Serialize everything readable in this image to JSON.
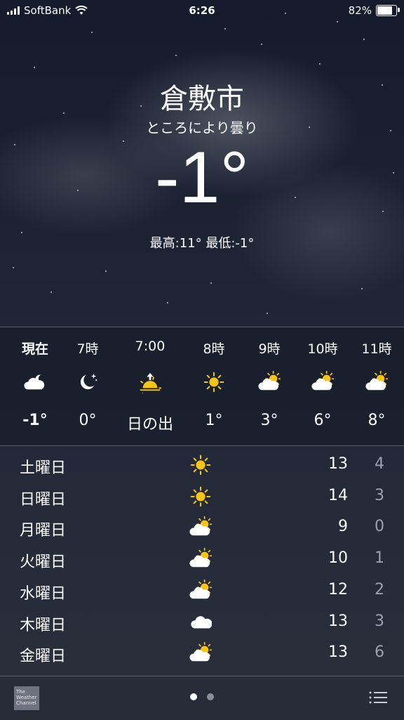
{
  "status_bar": {
    "carrier": "SoftBank",
    "time": "6:26",
    "battery": "82%"
  },
  "location": {
    "city": "倉敷市",
    "condition": "ところにより曇り",
    "temperature": "-1°",
    "hi_lo": "最高:11° 最低:-1°"
  },
  "hourly": [
    {
      "time": "現在",
      "icon": "partly-cloudy-night-icon",
      "value": "-1°",
      "bold": true
    },
    {
      "time": "7時",
      "icon": "moon-stars-icon",
      "value": "0°"
    },
    {
      "time": "7:00",
      "icon": "sunrise-icon",
      "value": "日の出"
    },
    {
      "time": "8時",
      "icon": "sun-icon",
      "value": "1°"
    },
    {
      "time": "9時",
      "icon": "partly-cloudy-day-icon",
      "value": "3°"
    },
    {
      "time": "10時",
      "icon": "partly-cloudy-day-icon",
      "value": "6°"
    },
    {
      "time": "11時",
      "icon": "partly-cloudy-day-icon",
      "value": "8°"
    }
  ],
  "daily": [
    {
      "day": "土曜日",
      "icon": "sun-icon",
      "high": "13",
      "low": "4"
    },
    {
      "day": "日曜日",
      "icon": "sun-icon",
      "high": "14",
      "low": "3"
    },
    {
      "day": "月曜日",
      "icon": "partly-cloudy-day-icon",
      "high": "9",
      "low": "0"
    },
    {
      "day": "火曜日",
      "icon": "partly-cloudy-day-icon",
      "high": "10",
      "low": "1"
    },
    {
      "day": "水曜日",
      "icon": "partly-cloudy-day-icon",
      "high": "12",
      "low": "2"
    },
    {
      "day": "木曜日",
      "icon": "cloud-icon",
      "high": "13",
      "low": "3"
    },
    {
      "day": "金曜日",
      "icon": "partly-cloudy-day-icon",
      "high": "13",
      "low": "6"
    }
  ],
  "bottom_bar": {
    "logo_lines": [
      "The",
      "Weather",
      "Channel"
    ],
    "page_count": 2,
    "active_page": 0
  },
  "colors": {
    "sun": "#f7c41a",
    "cloud": "#ffffff",
    "low_temp": "#9aa1ad"
  }
}
